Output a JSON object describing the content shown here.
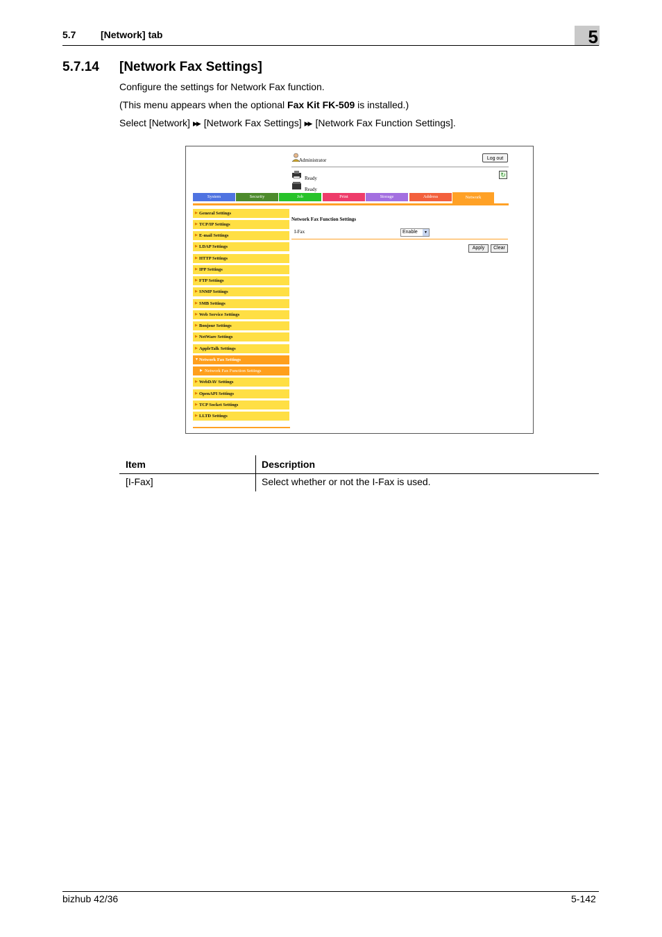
{
  "header": {
    "section": "5.7",
    "title": "[Network] tab",
    "chapter": "5"
  },
  "section": {
    "number": "5.7.14",
    "title": "[Network Fax Settings]"
  },
  "body": {
    "p1": "Configure the settings for Network Fax function.",
    "p2_pre": "(This menu appears when the optional ",
    "p2_bold": "Fax Kit FK-509",
    "p2_post": " is installed.)",
    "p3_a": "Select [Network]",
    "p3_b": "[Network Fax Settings]",
    "p3_c": "[Network Fax Function Settings].",
    "arrow": "▶▶"
  },
  "screenshot": {
    "user": "Administrator",
    "logout": "Log out",
    "status1": "Ready",
    "status2": "Ready",
    "tabs": [
      "System",
      "Security",
      "Job",
      "Print",
      "Storage",
      "Address",
      "Network"
    ],
    "nav": [
      "General Settings",
      "TCP/IP Settings",
      "E-mail Settings",
      "LDAP Settings",
      "HTTP Settings",
      "IPP Settings",
      "FTP Settings",
      "SNMP Settings",
      "SMB Settings",
      "Web Service Settings",
      "Bonjour Settings",
      "NetWare Settings",
      "AppleTalk Settings",
      "Network Fax Settings",
      "Network Fax Function Settings",
      "WebDAV Settings",
      "OpenAPI Settings",
      "TCP Socket Settings",
      "LLTD Settings"
    ],
    "content_title": "Network Fax Function Settings",
    "ifax_label": "I-Fax",
    "ifax_value": "Enable",
    "apply": "Apply",
    "clear": "Clear"
  },
  "table": {
    "headers": [
      "Item",
      "Description"
    ],
    "rows": [
      [
        "[I-Fax]",
        "Select whether or not the I-Fax is used."
      ]
    ]
  },
  "footer": {
    "left": "bizhub 42/36",
    "right": "5-142"
  }
}
